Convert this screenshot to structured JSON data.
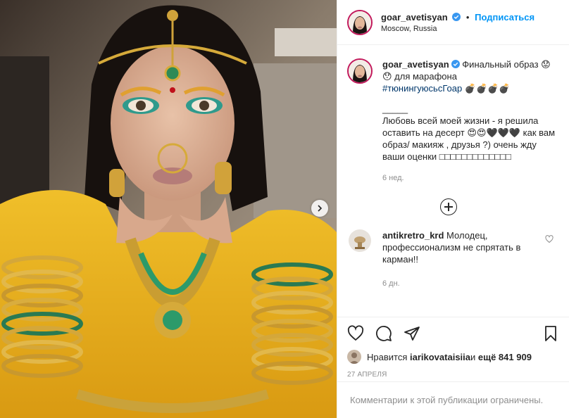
{
  "header": {
    "username": "goar_avetisyan",
    "separator": "•",
    "follow_label": "Подписаться",
    "location": "Moscow, Russia"
  },
  "caption": {
    "username": "goar_avetisyan",
    "line1": "Финальный образ 😟😯 для марафона",
    "hashtag": "#тюнингуюсьсГоар",
    "hashtag_suffix": " 💣💣💣💣",
    "divider": "_____",
    "body": "Любовь всей моей жизни - я решила оставить на десерт 😍😍🖤🖤🖤 как вам образ/ макияж , друзья ?) очень жду ваши оценки □□□□□□□□□□□□□",
    "time": "6 нед."
  },
  "comment": {
    "username": "antikretro_krd",
    "text": "Молодец, профессионализм не спрятать в карман!!",
    "time": "6 дн."
  },
  "likes": {
    "prefix": "Нравится ",
    "user": "iarikovataisiia",
    "middle": " и ",
    "count": "ещё 841 909"
  },
  "date": "27 АПРЕЛЯ",
  "comments_limited": "Комментарии к этой публикации ограничены.",
  "colors": {
    "follow": "#0095f6",
    "hashtag": "#00376b",
    "verified": "#3897f0",
    "muted": "#8e8e8e",
    "saree_yellow": "#e9b21e"
  },
  "icons": {
    "next": "chevron-right-icon",
    "like": "heart-icon",
    "comment": "comment-icon",
    "share": "paper-plane-icon",
    "save": "bookmark-icon",
    "add": "plus-circle-icon",
    "verified": "verified-badge-icon"
  }
}
